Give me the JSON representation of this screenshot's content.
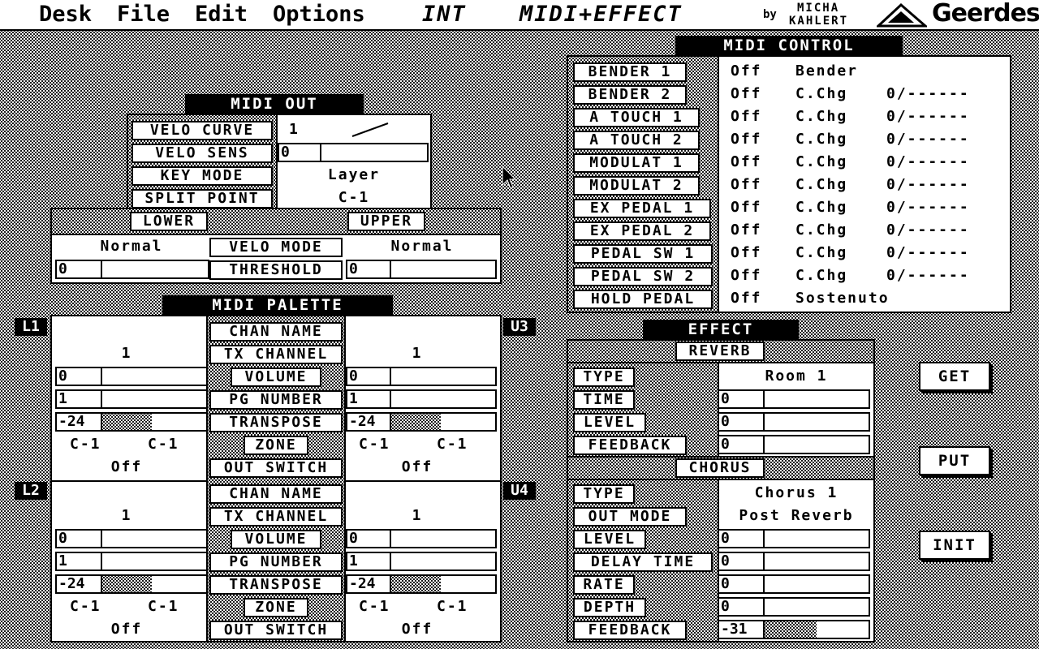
{
  "menubar": {
    "desk": "Desk",
    "file": "File",
    "edit": "Edit",
    "options": "Options",
    "int": "INT",
    "mode": "MIDI+EFFECT",
    "by": "by",
    "author1": "MICHA",
    "author2": "KAHLERT",
    "logo": "Geerdes",
    "logo_icon": "geerdes-triangle-logo-icon"
  },
  "midi_out": {
    "title": "MIDI OUT",
    "rows": [
      {
        "label": "VELO CURVE",
        "value": "1"
      },
      {
        "label": "VELO SENS",
        "value": "0"
      },
      {
        "label": "KEY MODE",
        "value": "Layer"
      },
      {
        "label": "SPLIT POINT",
        "value": "C-1"
      }
    ],
    "velo_sens_level": 0,
    "lower": "LOWER",
    "upper": "UPPER",
    "lower_mode": "Normal",
    "upper_mode": "Normal",
    "velo_mode": "VELO MODE",
    "threshold": "THRESHOLD",
    "lower_threshold": "0",
    "upper_threshold": "0"
  },
  "palette": {
    "title": "MIDI PALETTE",
    "center_labels": [
      "CHAN NAME",
      "TX CHANNEL",
      "VOLUME",
      "PG NUMBER",
      "TRANSPOSE",
      "ZONE",
      "OUT SWITCH"
    ],
    "parts": [
      {
        "tag": "L1",
        "channel": "1",
        "volume": "0",
        "pg": "1",
        "transpose": "-24",
        "zone_lo": "C-1",
        "zone_hi": "C-1",
        "switch": "Off"
      },
      {
        "tag": "U3",
        "channel": "1",
        "volume": "0",
        "pg": "1",
        "transpose": "-24",
        "zone_lo": "C-1",
        "zone_hi": "C-1",
        "switch": "Off"
      },
      {
        "tag": "L2",
        "channel": "1",
        "volume": "0",
        "pg": "1",
        "transpose": "-24",
        "zone_lo": "C-1",
        "zone_hi": "C-1",
        "switch": "Off"
      },
      {
        "tag": "U4",
        "channel": "1",
        "volume": "0",
        "pg": "1",
        "transpose": "-24",
        "zone_lo": "C-1",
        "zone_hi": "C-1",
        "switch": "Off"
      }
    ]
  },
  "midi_control": {
    "title": "MIDI CONTROL",
    "rows": [
      {
        "label": "BENDER 1",
        "state": "Off",
        "dest": "Bender",
        "val": ""
      },
      {
        "label": "BENDER 2",
        "state": "Off",
        "dest": "C.Chg",
        "val": "0/------"
      },
      {
        "label": "A TOUCH 1",
        "state": "Off",
        "dest": "C.Chg",
        "val": "0/------"
      },
      {
        "label": "A TOUCH 2",
        "state": "Off",
        "dest": "C.Chg",
        "val": "0/------"
      },
      {
        "label": "MODULAT 1",
        "state": "Off",
        "dest": "C.Chg",
        "val": "0/------"
      },
      {
        "label": "MODULAT 2",
        "state": "Off",
        "dest": "C.Chg",
        "val": "0/------"
      },
      {
        "label": "EX PEDAL 1",
        "state": "Off",
        "dest": "C.Chg",
        "val": "0/------"
      },
      {
        "label": "EX PEDAL 2",
        "state": "Off",
        "dest": "C.Chg",
        "val": "0/------"
      },
      {
        "label": "PEDAL SW 1",
        "state": "Off",
        "dest": "C.Chg",
        "val": "0/------"
      },
      {
        "label": "PEDAL SW 2",
        "state": "Off",
        "dest": "C.Chg",
        "val": "0/------"
      },
      {
        "label": "HOLD PEDAL",
        "state": "Off",
        "dest": "Sostenuto",
        "val": ""
      }
    ]
  },
  "effect": {
    "title": "EFFECT",
    "reverb": {
      "title": "REVERB",
      "type_label": "TYPE",
      "type": "Room 1",
      "rows": [
        {
          "label": "TIME",
          "value": "0"
        },
        {
          "label": "LEVEL",
          "value": "0"
        },
        {
          "label": "FEEDBACK",
          "value": "0"
        }
      ]
    },
    "chorus": {
      "title": "CHORUS",
      "type_label": "TYPE",
      "type": "Chorus 1",
      "out_label": "OUT MODE",
      "out": "Post Reverb",
      "rows": [
        {
          "label": "LEVEL",
          "value": "0"
        },
        {
          "label": "DELAY TIME",
          "value": "0"
        },
        {
          "label": "RATE",
          "value": "0"
        },
        {
          "label": "DEPTH",
          "value": "0"
        },
        {
          "label": "FEEDBACK",
          "value": "-31"
        }
      ]
    }
  },
  "buttons": {
    "get": "GET",
    "put": "PUT",
    "init": "INIT"
  }
}
